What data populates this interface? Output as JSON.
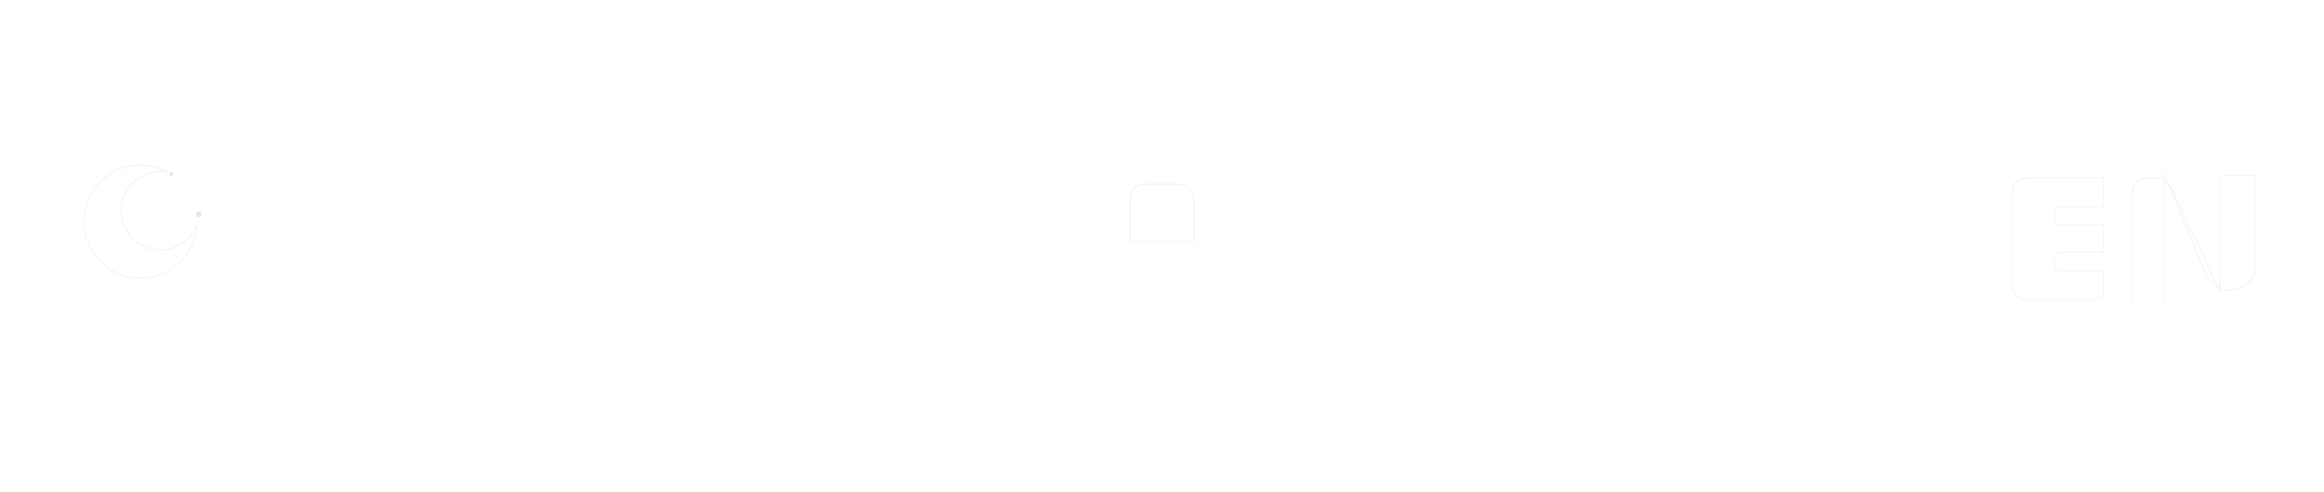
{
  "header": {
    "theme_toggle": {
      "icon": "moon-icon",
      "color": "#ffffff"
    },
    "center_control": {
      "icon": "lock-body-icon",
      "color": "#ffffff"
    },
    "language_switch": {
      "label": "EN",
      "icon": "language-en-icon",
      "color": "#ffffff"
    }
  }
}
